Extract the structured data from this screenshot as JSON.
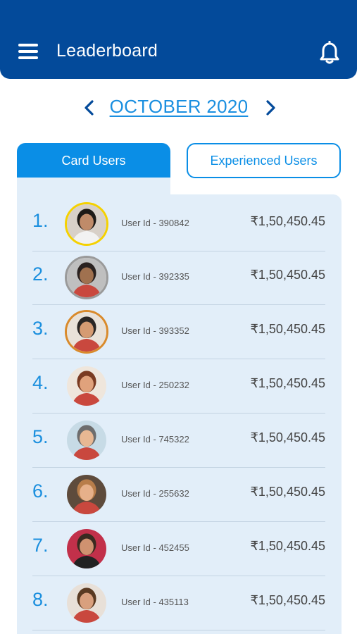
{
  "header": {
    "title": "Leaderboard"
  },
  "icons": {
    "menu": "hamburger-menu-icon",
    "notifications": "bell-icon",
    "prev": "chevron-left-icon",
    "next": "chevron-right-icon"
  },
  "period": {
    "label": "OCTOBER 2020"
  },
  "tabs": [
    {
      "label": "Card Users",
      "active": true
    },
    {
      "label": "Experienced Users",
      "active": false
    }
  ],
  "colors": {
    "header": "#034a9a",
    "accent": "#0a8ee6",
    "panel": "#e2eef9",
    "gold": "#f5d100",
    "silver": "#9a9a9a",
    "bronze": "#d98a2b"
  },
  "leaders": [
    {
      "rank": "1.",
      "user_id": "User Id - 390842",
      "amount": "₹1,50,450.45",
      "ring": "gold"
    },
    {
      "rank": "2.",
      "user_id": "User Id - 392335",
      "amount": "₹1,50,450.45",
      "ring": "silver"
    },
    {
      "rank": "3.",
      "user_id": "User Id - 393352",
      "amount": "₹1,50,450.45",
      "ring": "bronze"
    },
    {
      "rank": "4.",
      "user_id": "User Id - 250232",
      "amount": "₹1,50,450.45",
      "ring": "none"
    },
    {
      "rank": "5.",
      "user_id": "User Id - 745322",
      "amount": "₹1,50,450.45",
      "ring": "none"
    },
    {
      "rank": "6.",
      "user_id": "User Id - 255632",
      "amount": "₹1,50,450.45",
      "ring": "none"
    },
    {
      "rank": "7.",
      "user_id": "User Id - 452455",
      "amount": "₹1,50,450.45",
      "ring": "none"
    },
    {
      "rank": "8.",
      "user_id": "User Id - 435113",
      "amount": "₹1,50,450.45",
      "ring": "none"
    }
  ]
}
